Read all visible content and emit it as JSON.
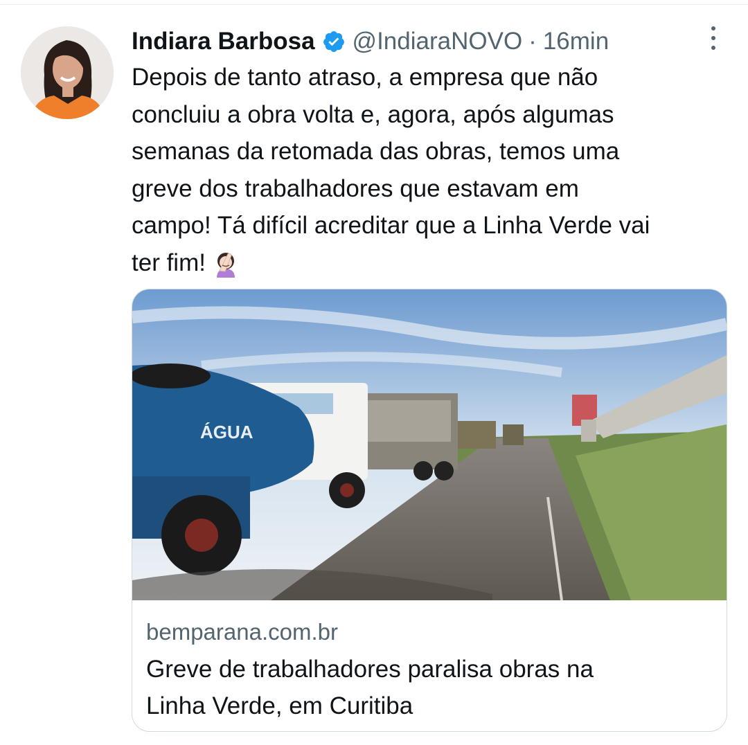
{
  "tweet": {
    "author_name": "Indiara Barbosa",
    "handle": "@IndiaraNOVO",
    "separator": "·",
    "time": "16min",
    "text_lines": [
      "Depois de tanto atraso, a empresa que não",
      "concluiu a obra volta e, agora, após algumas",
      "semanas da retomada das obras, temos uma",
      "greve dos trabalhadores que estavam em",
      "campo! Tá difícil acreditar que a Linha Verde vai",
      "ter fim!"
    ],
    "emoji": "woman-facepalming"
  },
  "card": {
    "domain": "bemparana.com.br",
    "title_lines": [
      "Greve de trabalhadores paralisa obras na",
      "Linha Verde, em Curitiba"
    ],
    "image_text": "ÁGUA"
  },
  "colors": {
    "verified": "#1d9bf0",
    "secondary_text": "#536471",
    "primary_text": "#0f1419",
    "card_border": "#cfd9de"
  },
  "icons": [
    "verified-badge-icon",
    "more-options-icon",
    "facepalm-emoji-icon"
  ]
}
